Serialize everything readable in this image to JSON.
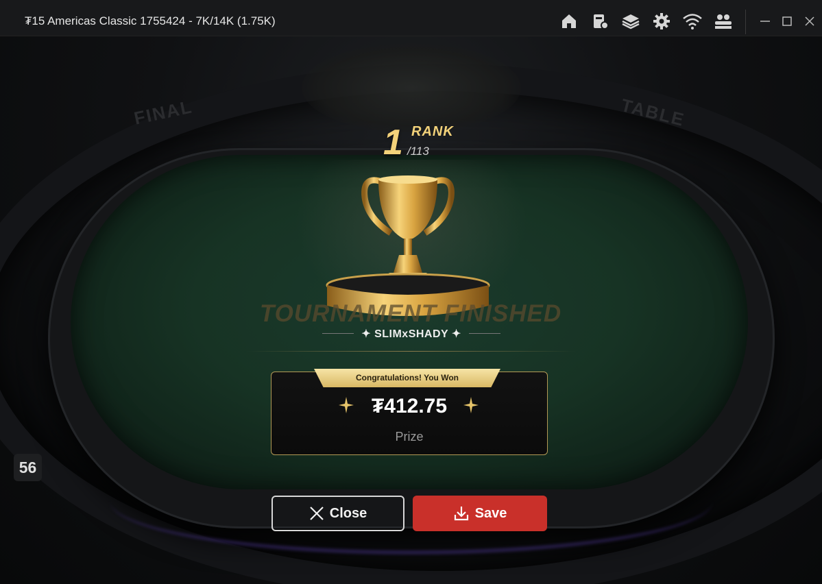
{
  "window": {
    "title": "₮15 Americas Classic 1755424 - 7K/14K (1.75K)",
    "toolbar_icons": [
      "home-icon",
      "cashier-icon",
      "layers-icon",
      "settings-icon",
      "wifi-icon",
      "players-icon"
    ],
    "controls": [
      "minimize-icon",
      "maximize-icon",
      "close-icon"
    ]
  },
  "scene": {
    "arena_left_text": "FINAL",
    "arena_right_text": "TABLE",
    "count_badge": "56"
  },
  "result": {
    "rank_number": "1",
    "rank_label": "RANK",
    "rank_total": "/113",
    "tournament_text": "TOURNAMENT FINISHED",
    "player_name": "✦ SLIMxSHADY ✦",
    "congrats": "Congratulations! You Won",
    "prize_amount": "₮412.75",
    "prize_label": "Prize"
  },
  "buttons": {
    "close_label": "Close",
    "save_label": "Save"
  },
  "colors": {
    "gold": "#f3d27a",
    "save_red": "#c9302a",
    "felt": "#173324"
  }
}
